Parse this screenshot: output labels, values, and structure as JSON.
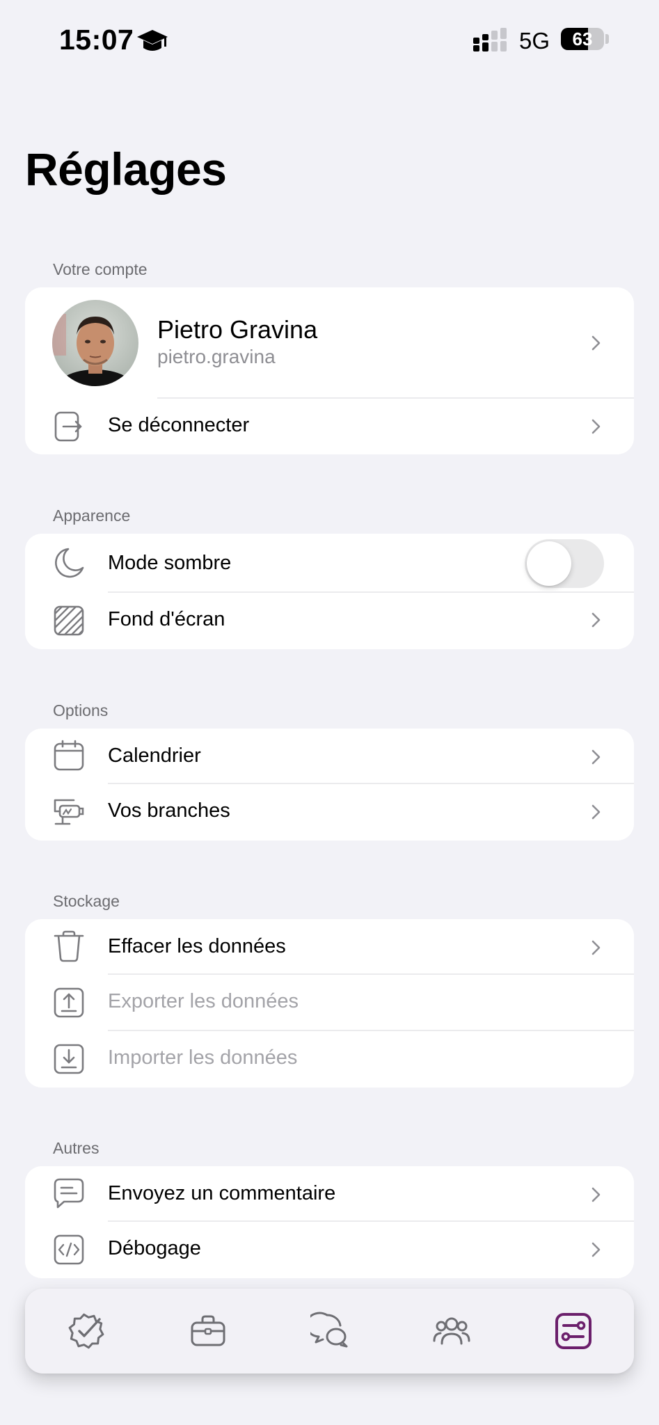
{
  "status_bar": {
    "time": "15:07",
    "network": "5G",
    "battery": "63",
    "icons": [
      "graduation-cap-icon",
      "signal-icon",
      "battery-icon"
    ]
  },
  "page": {
    "title": "Réglages"
  },
  "account": {
    "header": "Votre compte",
    "name": "Pietro Gravina",
    "handle": "pietro.gravina",
    "logout": "Se déconnecter"
  },
  "appearance": {
    "header": "Apparence",
    "dark_mode": "Mode sombre",
    "dark_mode_on": false,
    "wallpaper": "Fond d'écran"
  },
  "options": {
    "header": "Options",
    "calendar": "Calendrier",
    "branches": "Vos branches"
  },
  "storage": {
    "header": "Stockage",
    "clear": "Effacer les données",
    "export": "Exporter les données",
    "import": "Importer les données"
  },
  "others": {
    "header": "Autres",
    "feedback": "Envoyez un commentaire",
    "debug": "Débogage"
  },
  "tab_bar": {
    "tabs": [
      "tasks-icon",
      "briefcase-icon",
      "chat-icon",
      "people-icon",
      "settings-sliders-icon"
    ],
    "active_index": 4,
    "active_color": "#6b1f6b",
    "inactive_color": "#6e6e73"
  }
}
